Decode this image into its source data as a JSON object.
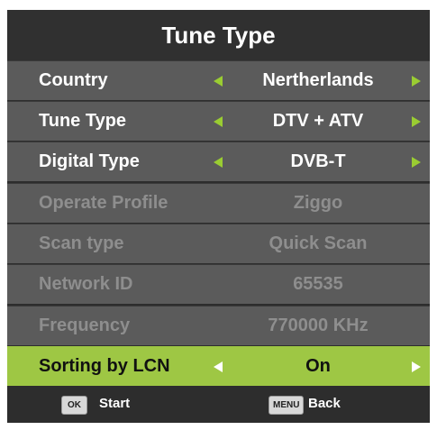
{
  "title": "Tune Type",
  "rows": [
    {
      "label": "Country",
      "value": "Nertherlands"
    },
    {
      "label": "Tune Type",
      "value": "DTV + ATV"
    },
    {
      "label": "Digital Type",
      "value": "DVB-T"
    },
    {
      "label": "Operate Profile",
      "value": "Ziggo"
    },
    {
      "label": "Scan type",
      "value": "Quick Scan"
    },
    {
      "label": "Network ID",
      "value": "65535"
    },
    {
      "label": "Frequency",
      "value": "770000 KHz"
    },
    {
      "label": "Sorting by LCN",
      "value": "On"
    }
  ],
  "footer": {
    "ok_key": "OK",
    "ok_label": "Start",
    "menu_key": "MENU",
    "menu_label": "Back"
  },
  "colors": {
    "accent": "#9ec744",
    "arrow": "#9acd32",
    "row_bg": "#5b5b5b",
    "disabled_text": "#8e8e8e"
  },
  "icons": [
    "left-arrow-icon",
    "right-arrow-icon"
  ]
}
